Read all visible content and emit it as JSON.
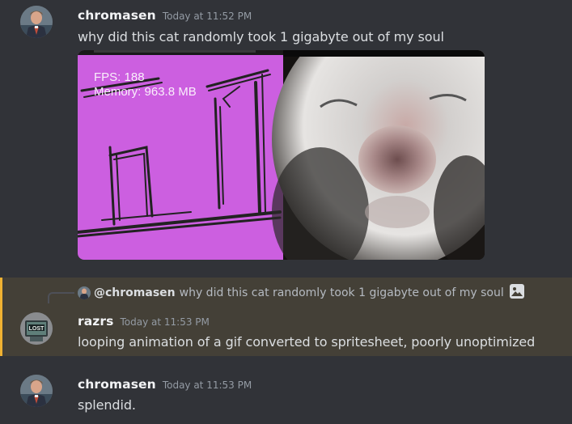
{
  "messages": [
    {
      "username": "chromasen",
      "timestamp": "Today at 11:52 PM",
      "content": "why did this cat randomly took 1 gigabyte out of my soul"
    },
    {
      "username": "razrs",
      "timestamp": "Today at 11:53 PM",
      "content": "looping animation of a gif converted to spritesheet, poorly unoptimized",
      "reply": {
        "mention": "@chromasen",
        "text": "why did this cat randomly took 1 gigabyte out of my soul"
      }
    },
    {
      "username": "chromasen",
      "timestamp": "Today at 11:53 PM",
      "content": "splendid."
    }
  ],
  "embed": {
    "overlay_fps": "FPS: 188",
    "overlay_memory": "Memory: 963.8 MB"
  },
  "icons": {
    "reply_attachment": "image-icon",
    "avatar_razrs_badge": "LOST"
  },
  "colors": {
    "background": "#313338",
    "mention_highlight": "#444037",
    "mention_bar": "#f0b232",
    "username": "#f2f3f5",
    "timestamp": "#949ba4",
    "embed_purple": "#cc5fe0"
  }
}
